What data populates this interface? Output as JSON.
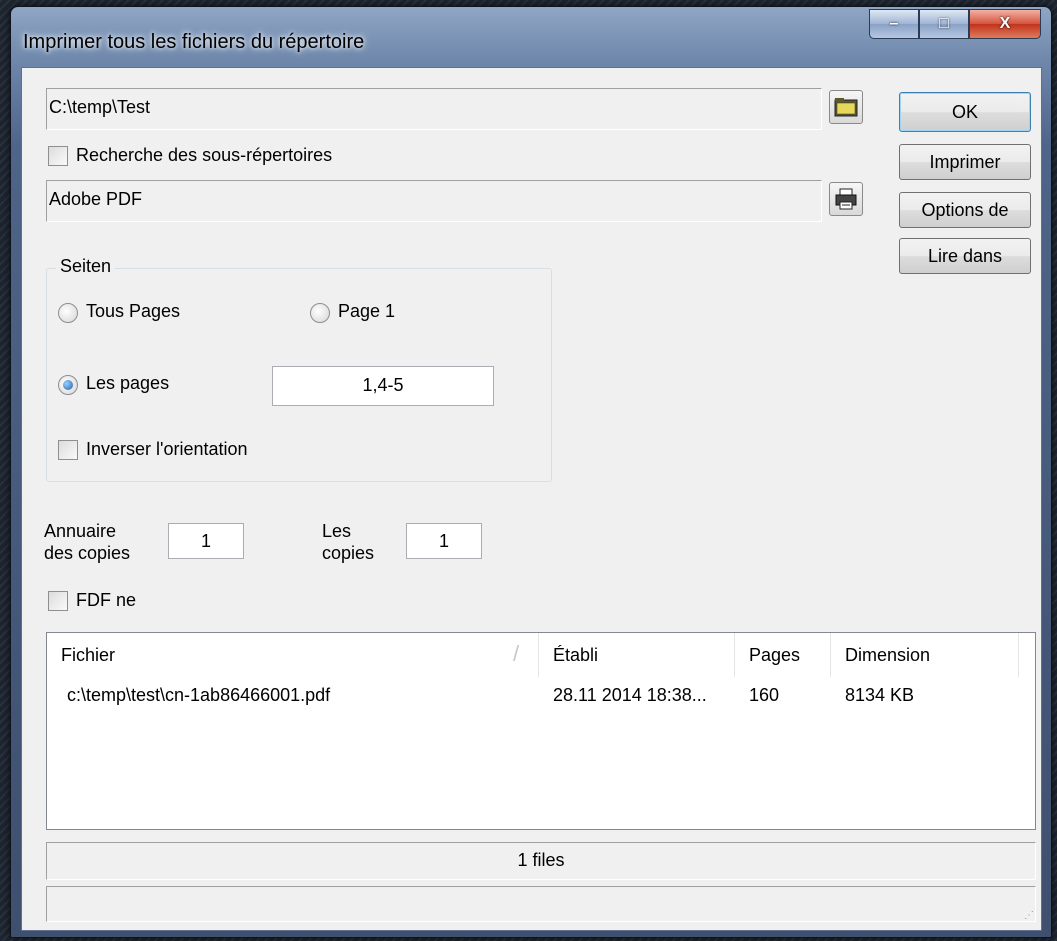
{
  "window": {
    "title": "Imprimer tous les fichiers du répertoire"
  },
  "caption_buttons": {
    "minimize": "–",
    "maximize": "□",
    "close": "X"
  },
  "directory_path": "C:\\temp\\Test",
  "subdirectories_checkbox": {
    "label": "Recherche des sous-répertoires",
    "checked": false
  },
  "printer_name": "Adobe PDF",
  "buttons": {
    "ok": "OK",
    "print": "Imprimer",
    "options": "Options de",
    "read_in": "Lire dans"
  },
  "pages_group": {
    "title": "Seiten",
    "all_pages": "Tous Pages",
    "page_1": "Page 1",
    "custom_pages": "Les pages",
    "custom_pages_value": "1,4-5",
    "selected": "custom_pages",
    "invert_orientation": "Inverser l'orientation"
  },
  "copies": {
    "directory_copies_label_1": "Annuaire",
    "directory_copies_label_2": "des copies",
    "directory_copies_value": "1",
    "copies_label_1": "Les",
    "copies_label_2": "copies",
    "copies_value": "1"
  },
  "fdf_checkbox": {
    "label": "FDF ne",
    "checked": false
  },
  "file_list": {
    "columns": [
      "Fichier",
      "Établi",
      "Pages",
      "Dimension"
    ],
    "rows": [
      {
        "file": "c:\\temp\\test\\cn-1ab86466001.pdf",
        "created": "28.11 2014 18:38...",
        "pages": "160",
        "size": "8134 KB"
      }
    ]
  },
  "status": {
    "count_text": "1 files",
    "secondary_text": ""
  },
  "colors": {
    "dialog_bg": "#f0f0f0",
    "title_glass": "#6b84a8",
    "close_red": "#c1331b"
  }
}
